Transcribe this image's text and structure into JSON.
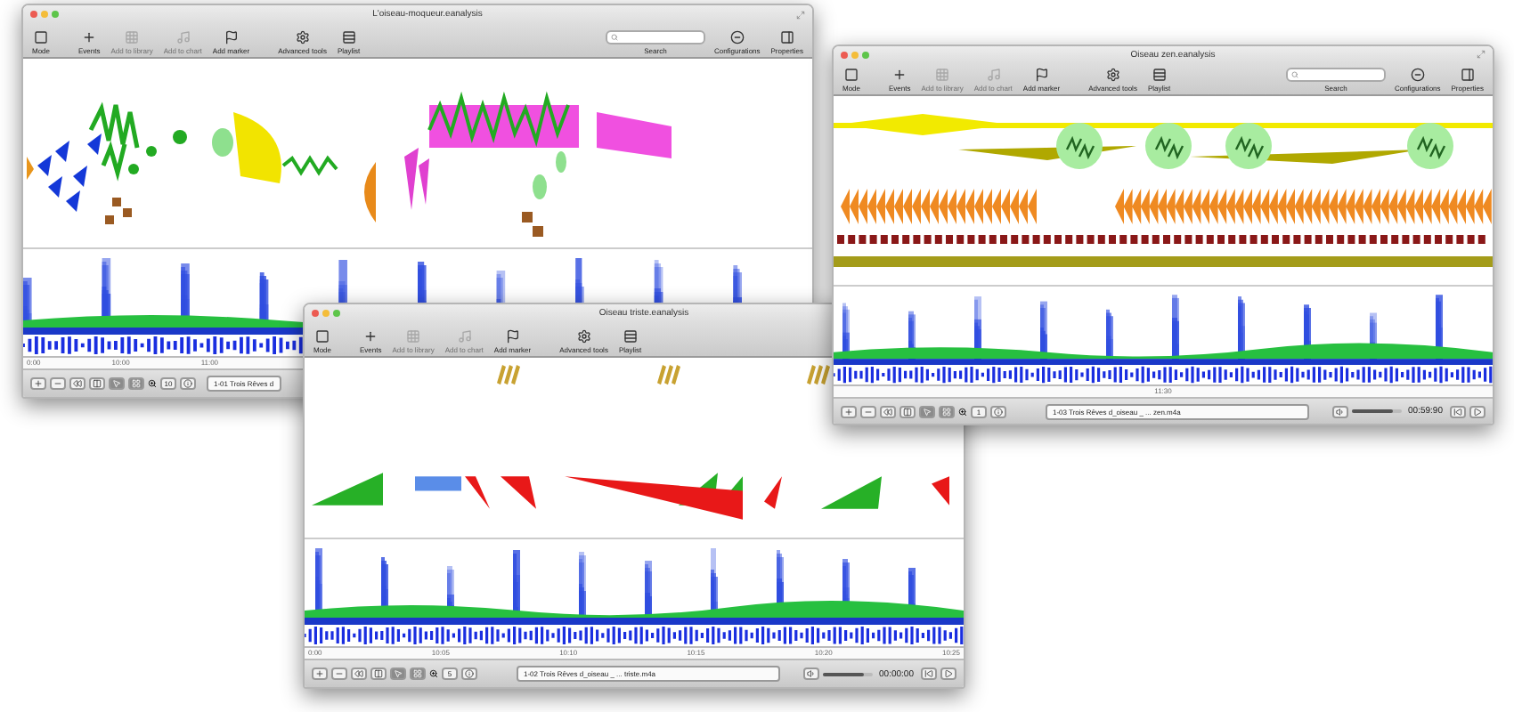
{
  "windows": [
    {
      "title": "L'oiseau-moqueur.eanalysis",
      "toolbar": [
        {
          "label": "Mode",
          "disabled": false
        },
        {
          "label": "Events",
          "disabled": false
        },
        {
          "label": "Add to library",
          "disabled": true
        },
        {
          "label": "Add to chart",
          "disabled": true
        },
        {
          "label": "Add marker",
          "disabled": false
        },
        {
          "label": "Advanced tools",
          "disabled": false
        },
        {
          "label": "Playlist",
          "disabled": false
        }
      ],
      "search_label": "Search",
      "side_tools": [
        {
          "label": "Configurations"
        },
        {
          "label": "Properties"
        }
      ],
      "ruler": [
        "0:00",
        "10:00",
        "11:00"
      ],
      "bottom": {
        "zoom": "10",
        "file": "1-01 Trois Rêves d"
      }
    },
    {
      "title": "Oiseau triste.eanalysis",
      "toolbar": [
        {
          "label": "Mode",
          "disabled": false
        },
        {
          "label": "Events",
          "disabled": false
        },
        {
          "label": "Add to library",
          "disabled": true
        },
        {
          "label": "Add to chart",
          "disabled": true
        },
        {
          "label": "Add marker",
          "disabled": false
        },
        {
          "label": "Advanced tools",
          "disabled": false
        },
        {
          "label": "Playlist",
          "disabled": false
        }
      ],
      "ruler": [
        "0:00",
        "10:05",
        "10:10",
        "10:15",
        "10:20",
        "10:25"
      ],
      "bottom": {
        "zoom": "5",
        "file": "1-02 Trois Rêves d_oiseau _ ... triste.m4a",
        "volume": {
          "level": 0.85
        },
        "time": "00:00:00"
      }
    },
    {
      "title": "Oiseau zen.eanalysis",
      "toolbar": [
        {
          "label": "Mode",
          "disabled": false
        },
        {
          "label": "Events",
          "disabled": false
        },
        {
          "label": "Add to library",
          "disabled": true
        },
        {
          "label": "Add to chart",
          "disabled": true
        },
        {
          "label": "Add marker",
          "disabled": false
        },
        {
          "label": "Advanced tools",
          "disabled": false
        },
        {
          "label": "Playlist",
          "disabled": false
        }
      ],
      "search_label": "Search",
      "side_tools": [
        {
          "label": "Configurations"
        },
        {
          "label": "Properties"
        }
      ],
      "ruler": [
        "11:30"
      ],
      "bottom": {
        "zoom": "1",
        "file": "1-03 Trois Rêves d_oiseau _ ... zen.m4a",
        "volume": {
          "level": 0.85
        },
        "time": "00:59:90"
      }
    }
  ]
}
